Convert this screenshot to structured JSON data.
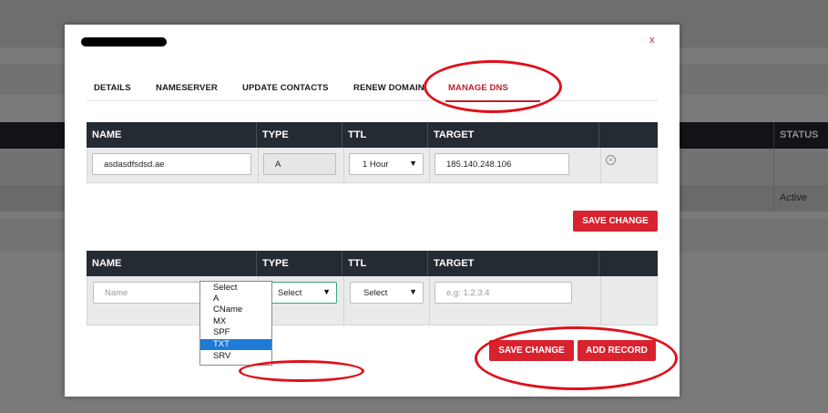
{
  "background": {
    "status_header": "STATUS",
    "status_value": "Active"
  },
  "modal": {
    "close_label": "x",
    "tabs": [
      {
        "label": "DETAILS"
      },
      {
        "label": "NAMESERVER"
      },
      {
        "label": "UPDATE CONTACTS"
      },
      {
        "label": "RENEW DOMAIN"
      },
      {
        "label": "MANAGE DNS"
      }
    ],
    "active_tab": "MANAGE DNS",
    "existing_records": {
      "headers": [
        "NAME",
        "TYPE",
        "TTL",
        "TARGET"
      ],
      "row": {
        "name": "asdasdfsdsd.ae",
        "type": "A",
        "ttl": "1 Hour",
        "target": "185.140.248.106"
      },
      "save_label": "SAVE CHANGE"
    },
    "new_record": {
      "headers": [
        "NAME",
        "TYPE",
        "TTL",
        "TARGET"
      ],
      "name_placeholder": "Name",
      "type_value": "Select",
      "ttl_value": "Select",
      "target_placeholder": "e.g: 1.2.3.4",
      "type_options": [
        "Select",
        "A",
        "CName",
        "MX",
        "SPF",
        "TXT",
        "SRV"
      ],
      "highlighted_option": "TXT",
      "save_label": "SAVE CHANGE",
      "add_label": "ADD RECORD"
    }
  },
  "colors": {
    "accent": "#d8232f",
    "header_bg": "#252b33",
    "annotation": "#e0101a"
  }
}
